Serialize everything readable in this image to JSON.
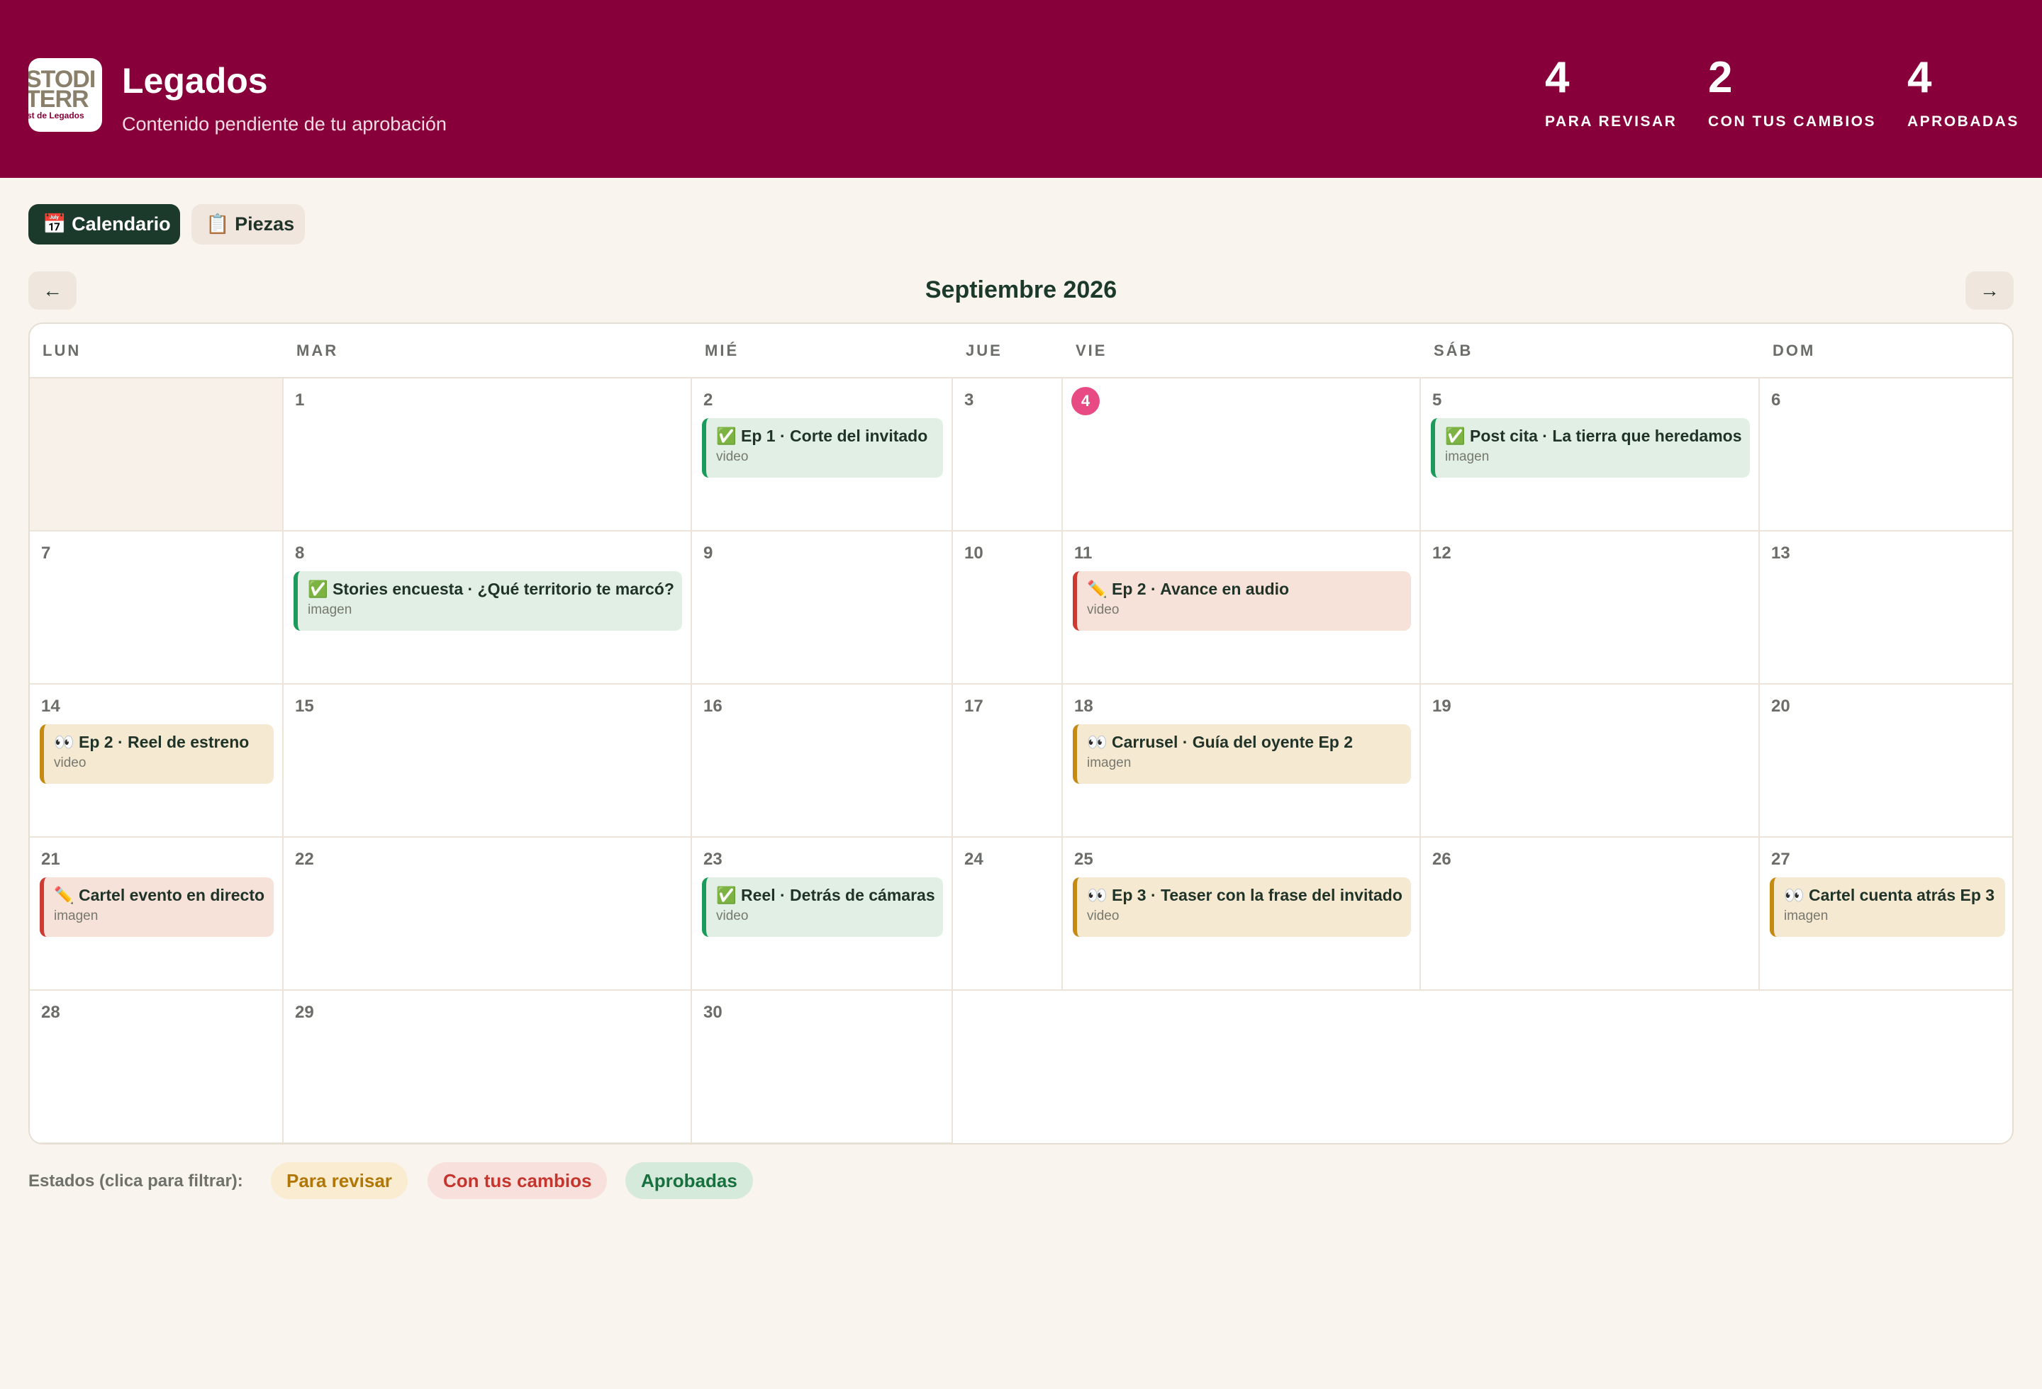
{
  "header": {
    "logo": {
      "line1": "STODI",
      "line2": "TERR",
      "line3": "st de Legados"
    },
    "title": "Legados",
    "subtitle": "Contenido pendiente de tu aprobación",
    "stats": [
      {
        "value": "4",
        "label": "PARA REVISAR"
      },
      {
        "value": "2",
        "label": "CON TUS CAMBIOS"
      },
      {
        "value": "4",
        "label": "APROBADAS"
      }
    ]
  },
  "tabs": [
    {
      "label": "📅 Calendario",
      "active": true
    },
    {
      "label": "📋 Piezas",
      "active": false
    }
  ],
  "nav": {
    "prev_icon": "←",
    "next_icon": "→",
    "month": "Septiembre 2026"
  },
  "weekdays": [
    "LUN",
    "MAR",
    "MIÉ",
    "JUE",
    "VIE",
    "SÁB",
    "DOM"
  ],
  "today": "4",
  "days": {
    "d1": "1",
    "d2": "2",
    "d3": "3",
    "d4": "4",
    "d5": "5",
    "d6": "6",
    "d7": "7",
    "d8": "8",
    "d9": "9",
    "d10": "10",
    "d11": "11",
    "d12": "12",
    "d13": "13",
    "d14": "14",
    "d15": "15",
    "d16": "16",
    "d17": "17",
    "d18": "18",
    "d19": "19",
    "d20": "20",
    "d21": "21",
    "d22": "22",
    "d23": "23",
    "d24": "24",
    "d25": "25",
    "d26": "26",
    "d27": "27",
    "d28": "28",
    "d29": "29",
    "d30": "30"
  },
  "events": {
    "e2": {
      "title": "✅ Ep 1 · Corte del invitado",
      "type": "video",
      "status": "approved"
    },
    "e5": {
      "title": "✅ Post cita · La tierra que heredamos",
      "type": "imagen",
      "status": "approved"
    },
    "e8": {
      "title": "✅ Stories encuesta · ¿Qué territorio te marcó?",
      "type": "imagen",
      "status": "approved"
    },
    "e11": {
      "title": "✏️ Ep 2 · Avance en audio",
      "type": "video",
      "status": "changes"
    },
    "e14": {
      "title": "👀 Ep 2 · Reel de estreno",
      "type": "video",
      "status": "review"
    },
    "e18": {
      "title": "👀 Carrusel · Guía del oyente Ep 2",
      "type": "imagen",
      "status": "review"
    },
    "e21": {
      "title": "✏️ Cartel evento en directo",
      "type": "imagen",
      "status": "changes"
    },
    "e23": {
      "title": "✅ Reel · Detrás de cámaras",
      "type": "video",
      "status": "approved"
    },
    "e25": {
      "title": "👀 Ep 3 · Teaser con la frase del invitado",
      "type": "video",
      "status": "review"
    },
    "e27": {
      "title": "👀 Cartel cuenta atrás Ep 3",
      "type": "imagen",
      "status": "review"
    }
  },
  "legend": {
    "label": "Estados (clica para filtrar):",
    "items": [
      "Para revisar",
      "Con tus cambios",
      "Aprobadas"
    ]
  },
  "colors": {
    "brand": "#88003a",
    "accent_dark": "#1c3a2b",
    "approved": "#1c9a5b",
    "review": "#c48a12",
    "changes": "#cc3a32",
    "today": "#e84a83"
  }
}
